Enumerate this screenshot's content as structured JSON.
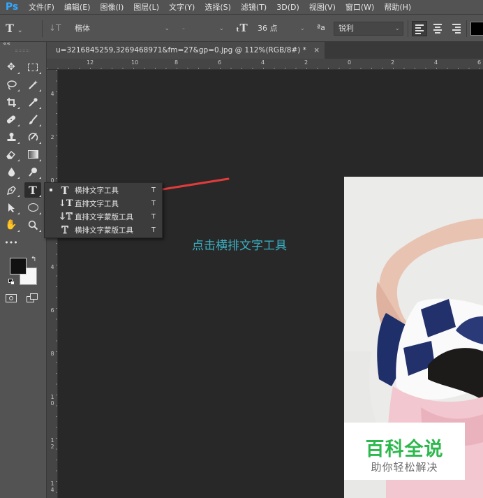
{
  "app": {
    "logo": "Ps",
    "accent": "#31a8ff"
  },
  "menubar": {
    "items": [
      "文件(F)",
      "编辑(E)",
      "图像(I)",
      "图层(L)",
      "文字(Y)",
      "选择(S)",
      "滤镜(T)",
      "3D(D)",
      "视图(V)",
      "窗口(W)",
      "帮助(H)"
    ]
  },
  "options": {
    "tool_icon": "T",
    "font_family": "楷体",
    "font_style": "-",
    "font_size": "36 点",
    "aa_icon": "ªa",
    "antialias": "锐利"
  },
  "tools": {
    "collapse": "««",
    "icons": [
      "move-icon",
      "marquee-icon",
      "lasso-icon",
      "magic-wand-icon",
      "crop-icon",
      "eyedropper-icon",
      "healing-brush-icon",
      "brush-icon",
      "clone-stamp-icon",
      "history-brush-icon",
      "eraser-icon",
      "gradient-icon",
      "blur-icon",
      "dodge-icon",
      "pen-icon",
      "type-icon",
      "path-select-icon",
      "ellipse-icon",
      "hand-icon",
      "zoom-icon",
      "more-icon"
    ],
    "more": "•••"
  },
  "document": {
    "tab_title": "u=3216845259,3269468971&fm=27&gp=0.jpg @ 112%(RGB/8#) *",
    "close": "×",
    "ruler_top": [
      "12",
      "10",
      "8",
      "6",
      "4",
      "2",
      "0",
      "2",
      "4",
      "6"
    ],
    "ruler_left": [
      "4",
      "2",
      "0",
      "2",
      "4",
      "6",
      "8",
      "10",
      "12",
      "14"
    ]
  },
  "flyout": {
    "items": [
      {
        "icon": "T",
        "label": "横排文字工具",
        "key": "T",
        "selected": true
      },
      {
        "icon": "↓T",
        "label": "直排文字工具",
        "key": "T",
        "selected": false
      },
      {
        "icon": "↓T",
        "label": "直排文字蒙版工具",
        "key": "T",
        "selected": false
      },
      {
        "icon": "T",
        "label": "横排文字蒙版工具",
        "key": "T",
        "selected": false
      }
    ]
  },
  "annotation": {
    "text": "点击横排文字工具",
    "color": "#3ab0c4",
    "arrow_color": "#e23b3b"
  },
  "watermark": {
    "title": "百科全说",
    "subtitle": "助你轻松解决",
    "color": "#2db84d"
  }
}
